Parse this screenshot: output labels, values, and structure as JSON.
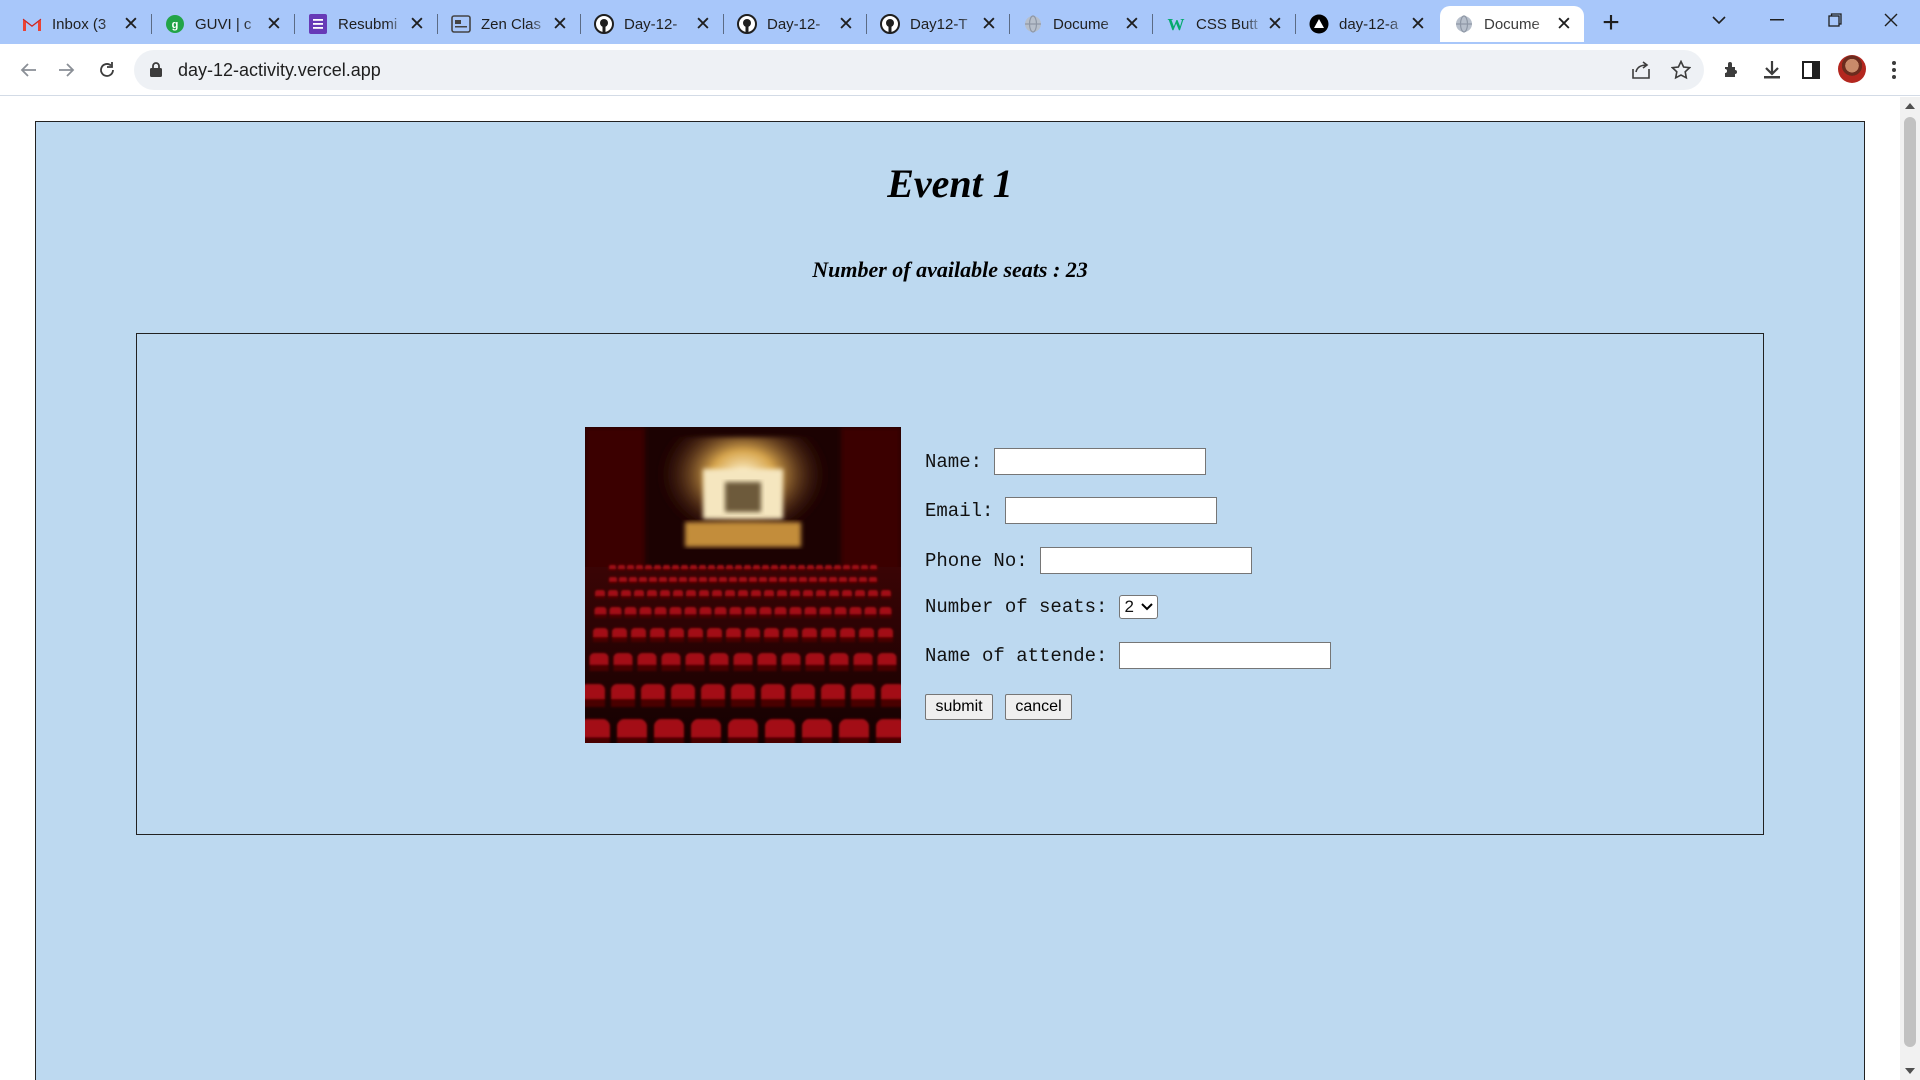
{
  "browser": {
    "tabs": [
      {
        "title": "Inbox (3",
        "icon": "gmail-icon"
      },
      {
        "title": "GUVI | c",
        "icon": "guvi-icon"
      },
      {
        "title": "Resubmi",
        "icon": "forms-icon"
      },
      {
        "title": "Zen Clas",
        "icon": "zen-class-icon"
      },
      {
        "title": "Day-12-",
        "icon": "github-icon"
      },
      {
        "title": "Day-12-",
        "icon": "github-icon"
      },
      {
        "title": "Day12-T",
        "icon": "github-icon"
      },
      {
        "title": "Docume",
        "icon": "globe-icon"
      },
      {
        "title": "CSS Butt",
        "icon": "w3-icon"
      },
      {
        "title": "day-12-a",
        "icon": "vercel-icon"
      },
      {
        "title": "Docume",
        "icon": "globe-icon",
        "active": true
      }
    ],
    "url": "day-12-activity.vercel.app"
  },
  "page": {
    "title": "Event 1",
    "seats_text": "Number of available seats : 23",
    "form": {
      "name_label": "Name:",
      "email_label": "Email:",
      "phone_label": "Phone No:",
      "seats_label": "Number of seats:",
      "seats_value": "2",
      "attendee_label": "Name of attende:",
      "submit_label": "submit",
      "cancel_label": "cancel"
    }
  },
  "colors": {
    "tabstrip": "#a8c7fa",
    "page_background": "#bdd9f0",
    "seat_red": "#a30f14"
  }
}
